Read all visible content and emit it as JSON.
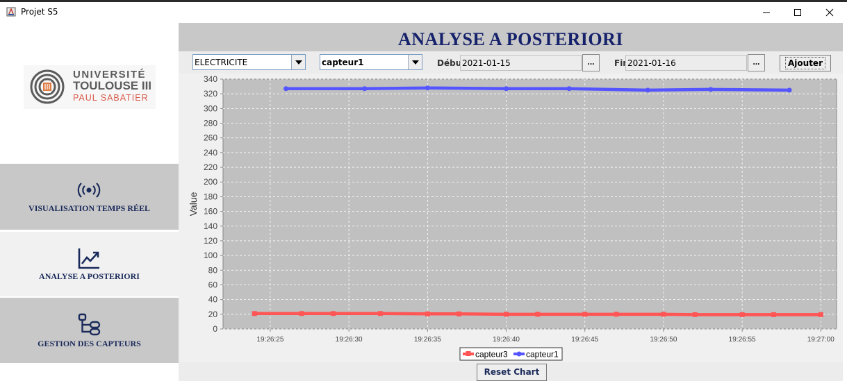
{
  "window": {
    "title": "Projet S5"
  },
  "sidebar": {
    "logo": {
      "line1": "UNIVERSITÉ",
      "line2": "TOULOUSE III",
      "line3": "PAUL SABATIER"
    },
    "items": [
      {
        "label": "VISUALISATION TEMPS RÉEL",
        "icon": "broadcast-icon",
        "active": false
      },
      {
        "label": "ANALYSE A POSTERIORI",
        "icon": "chart-line-icon",
        "active": true
      },
      {
        "label": "GESTION DES CAPTEURS",
        "icon": "nodes-icon",
        "active": false
      }
    ]
  },
  "main": {
    "title": "ANALYSE A POSTERIORI",
    "toolbar": {
      "type_select": "ELECTRICITE",
      "sensor_select": "capteur1",
      "start_label": "Début",
      "start_value": "2021-01-15",
      "end_label": "Fin",
      "end_value": "2021-01-16",
      "picker_label": "...",
      "add_label": "Ajouter"
    },
    "reset_label": "Reset Chart"
  },
  "colors": {
    "capteur3": "#ff5555",
    "capteur1": "#5555ff",
    "plot_bg": "#c0c0c0",
    "title": "#15226b"
  },
  "chart_data": {
    "type": "line",
    "title": "",
    "xlabel": "",
    "ylabel": "Value",
    "ylim": [
      0,
      340
    ],
    "yticks": [
      0,
      20,
      40,
      60,
      80,
      100,
      120,
      140,
      160,
      180,
      200,
      220,
      240,
      260,
      280,
      300,
      320,
      340
    ],
    "xlim": [
      "19:26:22",
      "19:27:01"
    ],
    "xticks": [
      "19:26:25",
      "19:26:30",
      "19:26:35",
      "19:26:40",
      "19:26:45",
      "19:26:50",
      "19:26:55",
      "19:27:00"
    ],
    "grid": true,
    "legend": "bottom",
    "series": [
      {
        "name": "capteur3",
        "points": [
          [
            "19:26:24",
            21
          ],
          [
            "19:26:27",
            21
          ],
          [
            "19:26:29",
            21
          ],
          [
            "19:26:32",
            21
          ],
          [
            "19:26:35",
            20.5
          ],
          [
            "19:26:37",
            20.5
          ],
          [
            "19:26:40",
            20
          ],
          [
            "19:26:42",
            20
          ],
          [
            "19:26:45",
            20
          ],
          [
            "19:26:47",
            20
          ],
          [
            "19:26:50",
            20
          ],
          [
            "19:26:52",
            19.5
          ],
          [
            "19:26:55",
            19.5
          ],
          [
            "19:26:57",
            19.5
          ],
          [
            "19:27:00",
            19.5
          ]
        ]
      },
      {
        "name": "capteur1",
        "points": [
          [
            "19:26:26",
            327
          ],
          [
            "19:26:31",
            327
          ],
          [
            "19:26:35",
            328
          ],
          [
            "19:26:40",
            327
          ],
          [
            "19:26:44",
            327
          ],
          [
            "19:26:49",
            325
          ],
          [
            "19:26:53",
            326
          ],
          [
            "19:26:58",
            325
          ]
        ]
      }
    ]
  }
}
